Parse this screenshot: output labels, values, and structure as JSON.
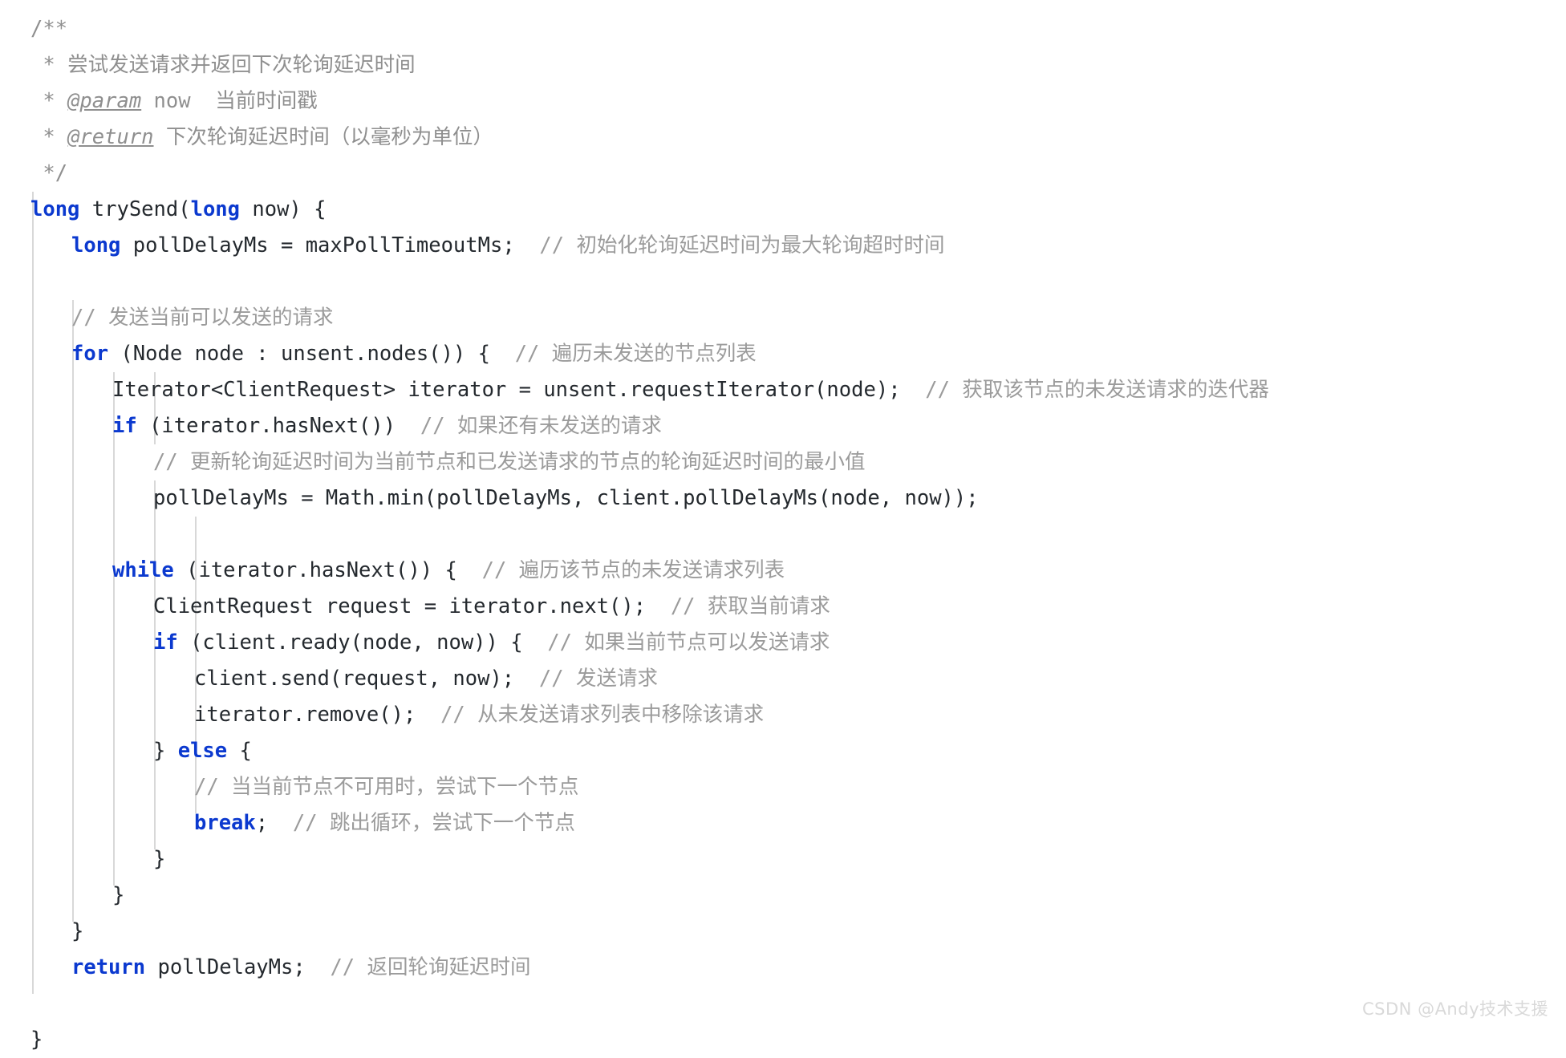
{
  "language": "java",
  "colors": {
    "background": "#ffffff",
    "keyword": "#0b39cf",
    "comment": "#9b9b9b",
    "text": "#24292e",
    "indent_guide": "#d8d8d8",
    "watermark": "#d9d9d9"
  },
  "watermark": "CSDN @Andy技术支援",
  "code": {
    "l1": "/**",
    "l2_star": " * ",
    "l2_text": "尝试发送请求并返回下次轮询延迟时间",
    "l3_star": " * ",
    "l3_tag": "@param",
    "l3_text": " now  当前时间戳",
    "l4_star": " * ",
    "l4_tag": "@return",
    "l4_text": " 下次轮询延迟时间（以毫秒为单位）",
    "l5": " */",
    "l6_kw1": "long",
    "l6_a": " trySend(",
    "l6_kw2": "long",
    "l6_b": " now) {",
    "l7_kw": "long",
    "l7_code": " pollDelayMs = maxPollTimeoutMs;",
    "l7_cmt": "// 初始化轮询延迟时间为最大轮询超时时间",
    "l9_cmt": "// 发送当前可以发送的请求",
    "l10_kw": "for",
    "l10_code": " (Node node : unsent.nodes()) {",
    "l10_cmt": "// 遍历未发送的节点列表",
    "l11_code": "Iterator<ClientRequest> iterator = unsent.requestIterator(node);",
    "l11_cmt": "// 获取该节点的未发送请求的迭代器",
    "l12_kw": "if",
    "l12_code": " (iterator.hasNext())",
    "l12_cmt": "// 如果还有未发送的请求",
    "l13_cmt": "// 更新轮询延迟时间为当前节点和已发送请求的节点的轮询延迟时间的最小值",
    "l14_code": "pollDelayMs = Math.min(pollDelayMs, client.pollDelayMs(node, now));",
    "l16_kw": "while",
    "l16_code": " (iterator.hasNext()) {",
    "l16_cmt": "// 遍历该节点的未发送请求列表",
    "l17_code": "ClientRequest request = iterator.next();",
    "l17_cmt": "// 获取当前请求",
    "l18_kw": "if",
    "l18_code": " (client.ready(node, now)) {",
    "l18_cmt": "// 如果当前节点可以发送请求",
    "l19_code": "client.send(request, now);",
    "l19_cmt": "// 发送请求",
    "l20_code": "iterator.remove();",
    "l20_cmt": "// 从未发送请求列表中移除该请求",
    "l21_brace": "} ",
    "l21_kw": "else",
    "l21_open": " {",
    "l22_cmt": "// 当当前节点不可用时，尝试下一个节点",
    "l23_kw": "break",
    "l23_code": ";",
    "l23_cmt": "// 跳出循环，尝试下一个节点",
    "l24": "}",
    "l25": "}",
    "l26": "}",
    "l27_kw": "return",
    "l27_code": " pollDelayMs;",
    "l27_cmt": "// 返回轮询延迟时间",
    "l29": "}"
  }
}
